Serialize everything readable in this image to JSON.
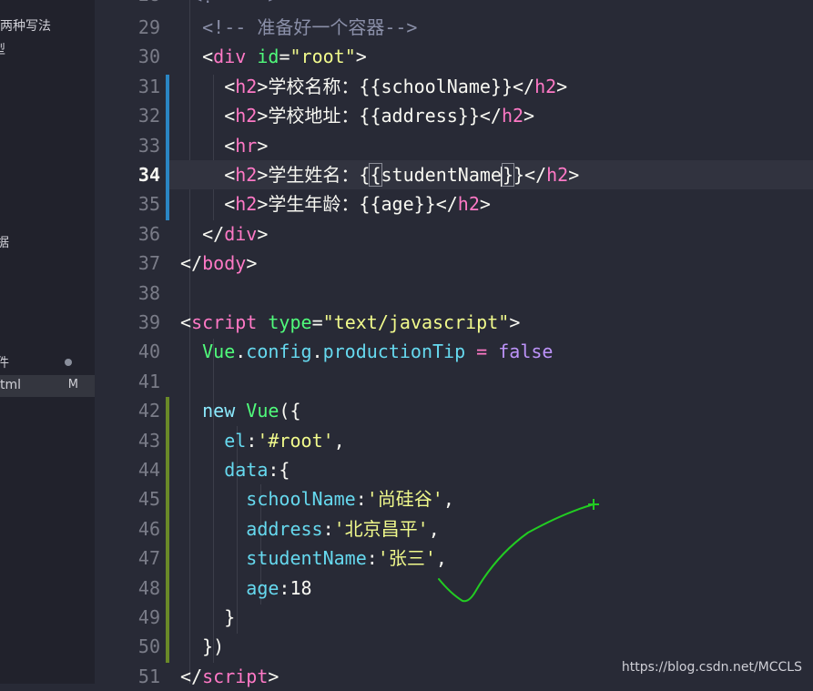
{
  "sidebar": {
    "items": [
      {
        "label": "两种写法",
        "badge": ""
      },
      {
        "label": "型",
        "badge": ""
      },
      {
        "label": "据",
        "badge": ""
      },
      {
        "label": "件",
        "badge": "dot"
      },
      {
        "label": "tml",
        "badge": "M"
      }
    ]
  },
  "gutter": {
    "line_numbers": [
      "29",
      "30",
      "31",
      "32",
      "33",
      "34",
      "35",
      "36",
      "37",
      "38",
      "39",
      "40",
      "41",
      "42",
      "43",
      "44",
      "45",
      "46",
      "47",
      "48",
      "49",
      "50",
      "51"
    ],
    "active_line": "34"
  },
  "code": {
    "l29": {
      "comment": "<!-- 准备好一个容器-->"
    },
    "l30": {
      "open": "<",
      "tag": "div",
      "attr": "id",
      "eq": "=",
      "str": "\"root\"",
      "close": ">"
    },
    "l31": {
      "o1": "<",
      "tag": "h2",
      "c1": ">",
      "text": "学校名称：",
      "mustache": "{{schoolName}}",
      "o2": "</",
      "tag2": "h2",
      "c2": ">"
    },
    "l32": {
      "o1": "<",
      "tag": "h2",
      "c1": ">",
      "text": "学校地址：",
      "mustache": "{{address}}",
      "o2": "</",
      "tag2": "h2",
      "c2": ">"
    },
    "l33": {
      "o1": "<",
      "tag": "hr",
      "c1": ">"
    },
    "l34": {
      "o1": "<",
      "tag": "h2",
      "c1": ">",
      "text": "学生姓名：",
      "m_open": "{",
      "m_open2": "{",
      "m_var": "studentName",
      "m_close": "}",
      "m_close2": "}",
      "o2": "</",
      "tag2": "h2",
      "c2": ">"
    },
    "l35": {
      "o1": "<",
      "tag": "h2",
      "c1": ">",
      "text": "学生年龄：",
      "mustache": "{{age}}",
      "o2": "</",
      "tag2": "h2",
      "c2": ">"
    },
    "l36": {
      "o1": "</",
      "tag": "div",
      "c1": ">"
    },
    "l37": {
      "o1": "</",
      "tag": "body",
      "c1": ">"
    },
    "l39": {
      "o1": "<",
      "tag": "script",
      "attr": "type",
      "eq": "=",
      "str": "\"text/javascript\"",
      "c1": ">"
    },
    "l40": {
      "obj": "Vue",
      "dot1": ".",
      "p1": "config",
      "dot2": ".",
      "p2": "productionTip",
      "op": " = ",
      "val": "false"
    },
    "l42": {
      "kw": "new",
      "cls": "Vue",
      "rest": "({"
    },
    "l43": {
      "key": "el",
      "colon": ":",
      "str": "'#root'",
      "comma": ","
    },
    "l44": {
      "key": "data",
      "rest": ":{"
    },
    "l45": {
      "key": "schoolName",
      "colon": ":",
      "str": "'尚硅谷'",
      "comma": ","
    },
    "l46": {
      "key": "address",
      "colon": ":",
      "str": "'北京昌平'",
      "comma": ","
    },
    "l47": {
      "key": "studentName",
      "colon": ":",
      "str": "'张三'",
      "comma": ","
    },
    "l48": {
      "key": "age",
      "colon": ":",
      "num": "18"
    },
    "l49": {
      "text": "}"
    },
    "l50": {
      "text": "})"
    },
    "l51": {
      "o1": "</",
      "tag": "script",
      "c1": ">"
    }
  },
  "watermark": "https://blog.csdn.net/MCCLS",
  "colors": {
    "background": "#282a36",
    "tag": "#ff79c6",
    "attribute": "#50fa7b",
    "string": "#f1fa8c",
    "annotation_check": "#22cc22"
  }
}
